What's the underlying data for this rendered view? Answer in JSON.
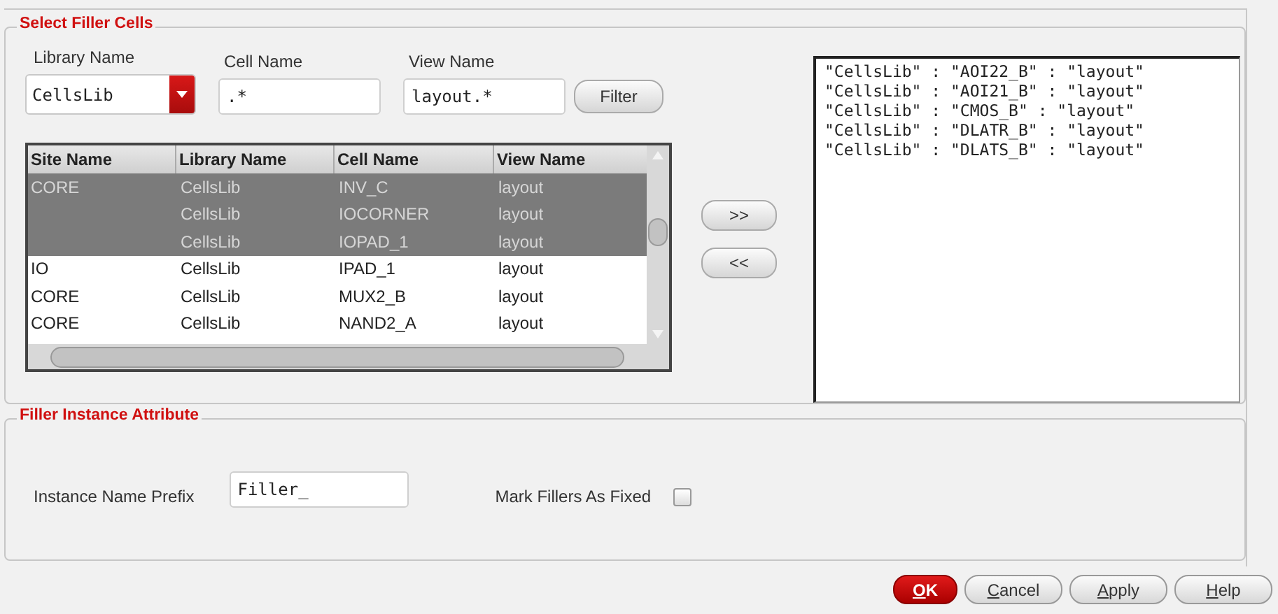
{
  "select_group": {
    "title": "Select Filler Cells",
    "library": {
      "label": "Library Name",
      "value": "CellsLib"
    },
    "cell": {
      "label": "Cell Name",
      "value": ".*"
    },
    "view": {
      "label": "View Name",
      "value": "layout.*"
    },
    "filter_button": "Filter",
    "table": {
      "columns": [
        "Site Name",
        "Library Name",
        "Cell Name",
        "View Name"
      ],
      "rows": [
        {
          "cells": [
            "CORE",
            "CellsLib",
            "INV_C",
            "layout"
          ],
          "selected": true
        },
        {
          "cells": [
            "",
            "CellsLib",
            "IOCORNER",
            "layout"
          ],
          "selected": true
        },
        {
          "cells": [
            "",
            "CellsLib",
            "IOPAD_1",
            "layout"
          ],
          "selected": true
        },
        {
          "cells": [
            "IO",
            "CellsLib",
            "IPAD_1",
            "layout"
          ],
          "selected": false
        },
        {
          "cells": [
            "CORE",
            "CellsLib",
            "MUX2_B",
            "layout"
          ],
          "selected": false
        },
        {
          "cells": [
            "CORE",
            "CellsLib",
            "NAND2_A",
            "layout"
          ],
          "selected": false
        }
      ]
    },
    "add_button": ">>",
    "remove_button": "<<",
    "chosen": [
      "\"CellsLib\" : \"AOI22_B\" : \"layout\"",
      "\"CellsLib\" : \"AOI21_B\" : \"layout\"",
      "\"CellsLib\" : \"CMOS_B\" : \"layout\"",
      "\"CellsLib\" : \"DLATR_B\" : \"layout\"",
      "\"CellsLib\" : \"DLATS_B\" : \"layout\""
    ]
  },
  "attribute_group": {
    "title": "Filler Instance Attribute",
    "prefix": {
      "label": "Instance Name Prefix",
      "value": "Filler_"
    },
    "fixed": {
      "label": "Mark Fillers As Fixed",
      "checked": false
    }
  },
  "buttons": [
    {
      "label": "OK",
      "kind": "primary"
    },
    {
      "label": "Cancel",
      "kind": "normal"
    },
    {
      "label": "Apply",
      "kind": "normal"
    },
    {
      "label": "Help",
      "kind": "normal"
    }
  ]
}
